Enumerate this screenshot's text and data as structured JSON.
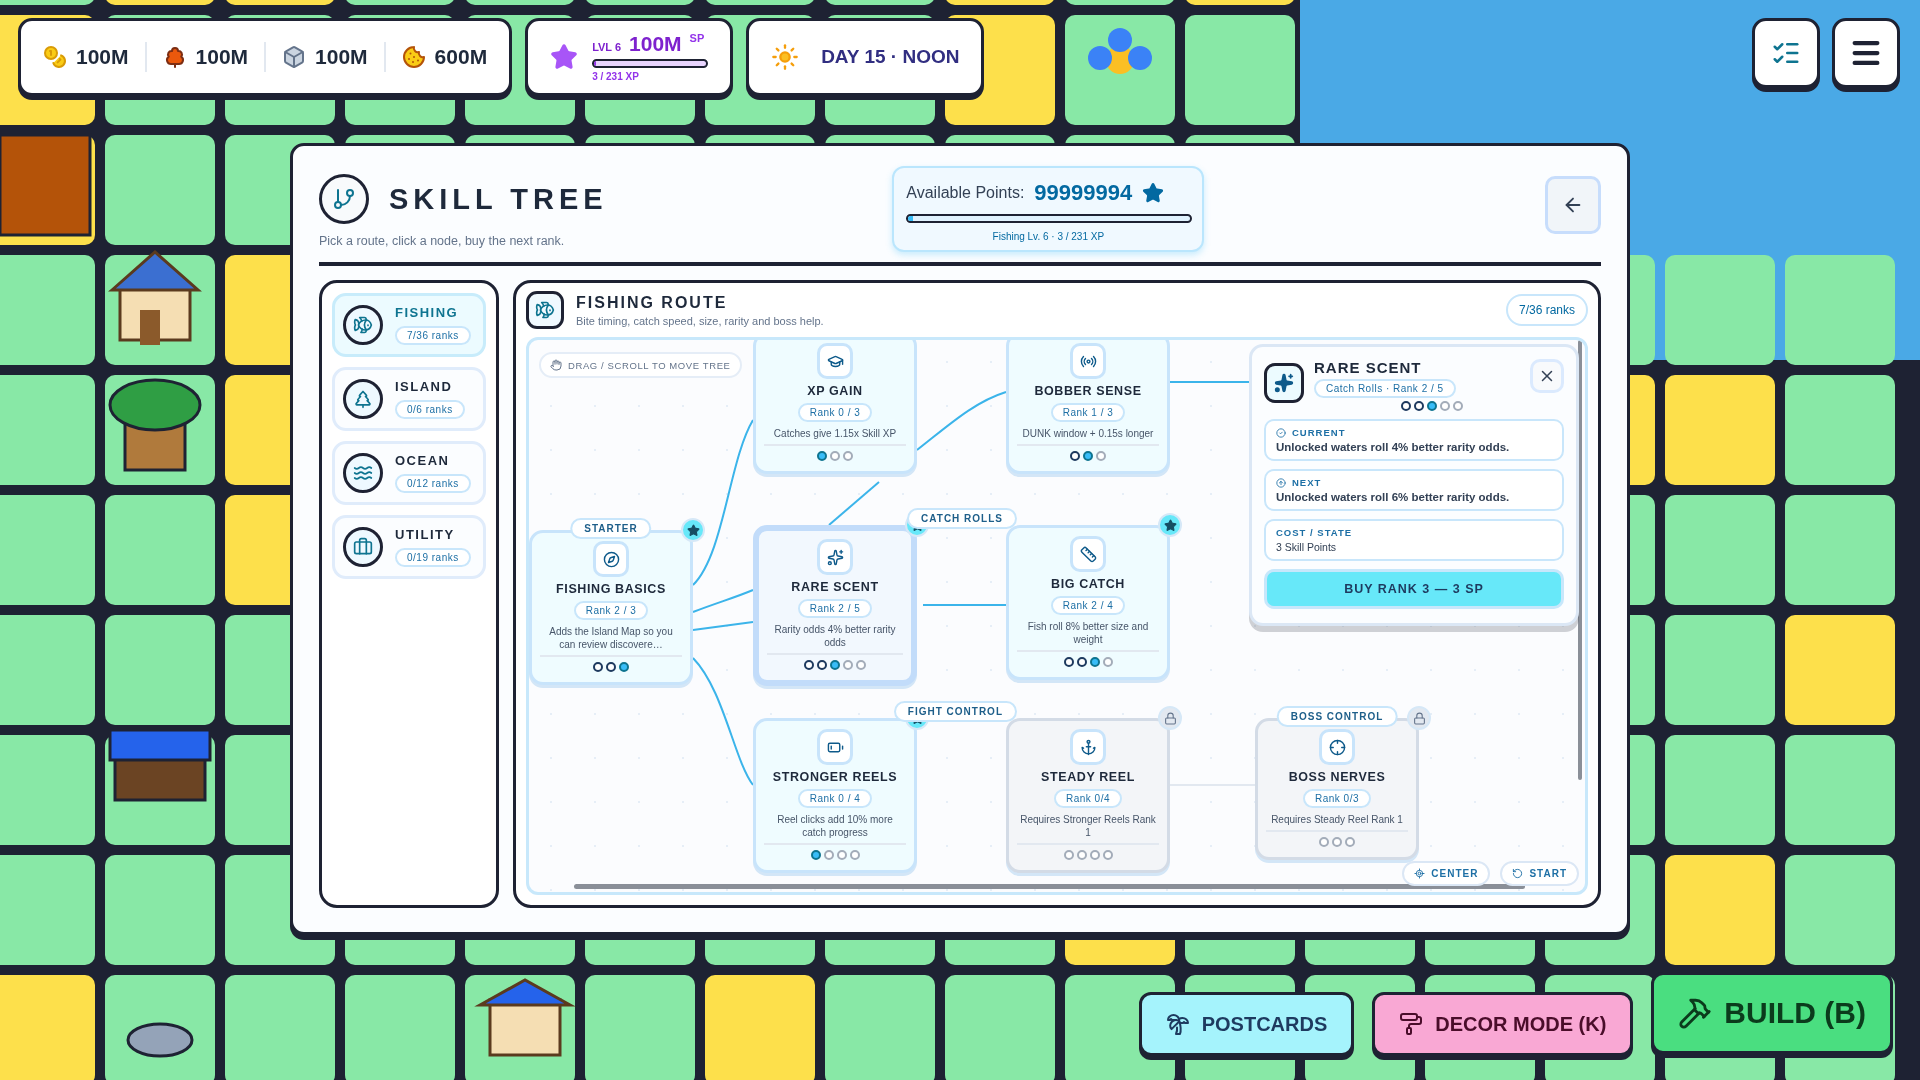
{
  "hud": {
    "resources": [
      {
        "amount": "100M"
      },
      {
        "amount": "100M"
      },
      {
        "amount": "100M"
      },
      {
        "amount": "600M"
      }
    ],
    "level": {
      "label": "LVL 6",
      "value": "100M",
      "unit": "SP",
      "level": 0.015,
      "xp": "3 / 231 XP"
    },
    "time": "DAY 15 · NOON"
  },
  "skill_tree": {
    "title": "SKILL TREE",
    "subtitle": "Pick a route, click a node, buy the next rank.",
    "points": {
      "label": "Available Points:",
      "value": "99999994",
      "level": 0.015,
      "caption": "Fishing Lv. 6 · 3 / 231 XP"
    }
  },
  "routes": [
    {
      "name": "FISHING",
      "ranks": "7/36 ranks",
      "selected": true
    },
    {
      "name": "ISLAND",
      "ranks": "0/6 ranks",
      "selected": false
    },
    {
      "name": "OCEAN",
      "ranks": "0/12 ranks",
      "selected": false
    },
    {
      "name": "UTILITY",
      "ranks": "0/19 ranks",
      "selected": false
    }
  ],
  "route": {
    "title": "FISHING ROUTE",
    "subtitle": "Bite timing, catch speed, size, rarity and boss help.",
    "ranks": "7/36 ranks",
    "hint": "DRAG / SCROLL TO MOVE TREE",
    "nodes": [
      {
        "title": "XP GAIN",
        "rank": "Rank 0 / 3",
        "desc": "Catches give 1.15x Skill XP",
        "pips": [
          {
            "kind": "next"
          },
          {
            "kind": "empty"
          },
          {
            "kind": "empty"
          }
        ],
        "selected": false,
        "starred": false,
        "locked": false
      },
      {
        "title": "BOBBER SENSE",
        "rank": "Rank 1 / 3",
        "desc": "DUNK window + 0.15s longer",
        "pips": [
          {
            "kind": "owned"
          },
          {
            "kind": "next"
          },
          {
            "kind": "empty"
          }
        ],
        "selected": false,
        "starred": false,
        "locked": false
      },
      {
        "title": "FISHING BASICS",
        "tag": "STARTER",
        "rank": "Rank 2 / 3",
        "desc": "Adds the Island Map so you can review discovere…",
        "pips": [
          {
            "kind": "owned"
          },
          {
            "kind": "owned"
          },
          {
            "kind": "next"
          }
        ],
        "selected": false,
        "starred": true,
        "locked": false
      },
      {
        "title": "RARE SCENT",
        "tag": "CATCH ROLLS",
        "rank": "Rank 2 / 5",
        "desc": "Rarity odds 4% better rarity odds",
        "pips": [
          {
            "kind": "owned"
          },
          {
            "kind": "owned"
          },
          {
            "kind": "next"
          },
          {
            "kind": "empty"
          },
          {
            "kind": "empty"
          }
        ],
        "selected": true,
        "starred": true,
        "locked": false
      },
      {
        "title": "BIG CATCH",
        "rank": "Rank 2 / 4",
        "desc": "Fish roll 8% better size and weight",
        "pips": [
          {
            "kind": "owned"
          },
          {
            "kind": "owned"
          },
          {
            "kind": "next"
          },
          {
            "kind": "empty"
          }
        ],
        "selected": false,
        "starred": true,
        "locked": false
      },
      {
        "title": "STRONGER REELS",
        "tag": "FIGHT CONTROL",
        "rank": "Rank 0 / 4",
        "desc": "Reel clicks add 10% more catch progress",
        "pips": [
          {
            "kind": "next"
          },
          {
            "kind": "empty"
          },
          {
            "kind": "empty"
          },
          {
            "kind": "empty"
          }
        ],
        "selected": false,
        "starred": true,
        "locked": false
      },
      {
        "title": "STEADY REEL",
        "rank": "Rank 0/4",
        "desc": "Requires Stronger Reels Rank 1",
        "pips": [
          {
            "kind": "empty"
          },
          {
            "kind": "empty"
          },
          {
            "kind": "empty"
          },
          {
            "kind": "empty"
          }
        ],
        "selected": false,
        "starred": false,
        "locked": true
      },
      {
        "title": "BOSS NERVES",
        "tag": "BOSS CONTROL",
        "rank": "Rank 0/3",
        "desc": "Requires Steady Reel Rank 1",
        "pips": [
          {
            "kind": "empty"
          },
          {
            "kind": "empty"
          },
          {
            "kind": "empty"
          }
        ],
        "selected": false,
        "starred": false,
        "locked": true
      }
    ],
    "details": {
      "title": "RARE SCENT",
      "meta": "Catch Rolls · Rank 2 / 5",
      "pips": [
        {
          "kind": "owned"
        },
        {
          "kind": "owned"
        },
        {
          "kind": "next"
        },
        {
          "kind": "empty"
        },
        {
          "kind": "empty"
        }
      ],
      "sections": [
        {
          "kind": "current",
          "label": "CURRENT",
          "text": "Unlocked waters roll 4% better rarity odds."
        },
        {
          "kind": "next",
          "label": "NEXT",
          "text": "Unlocked waters roll 6% better rarity odds."
        },
        {
          "kind": "cost",
          "label": "COST / STATE",
          "text": "3 Skill Points"
        }
      ],
      "buy": "BUY RANK 3 — 3 SP"
    },
    "controls": [
      "CENTER",
      "START"
    ]
  },
  "actions": [
    {
      "kind": "postcards",
      "label": "POSTCARDS"
    },
    {
      "kind": "decor",
      "label": "DECOR MODE (K)"
    },
    {
      "kind": "build",
      "label": "BUILD (B)"
    }
  ]
}
